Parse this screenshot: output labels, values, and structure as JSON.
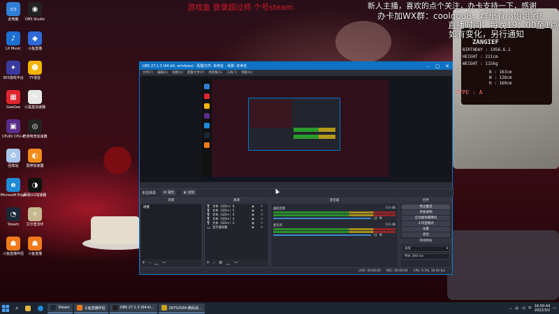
{
  "overlays": {
    "red_text": "游戏盒  登录超过师  个号steam",
    "line1": "新人主播，喜欢的点个关注，办卡支持一下，感谢",
    "line2": "办卡加WX群：coolgou8，群里有小姐姐哟！",
    "line3": "直播时间：每晚19：00至1点",
    "line4": "如有变化，另行通知"
  },
  "wallpaper_text": {
    "name": "ZANGIEF",
    "birthday": "BIRTHDAY : 1956.6.1",
    "height": "HEIGHT : 211cm",
    "weight": "WEIGHT : 115kg",
    "b": "B : 163cm",
    "w": "W : 128cm",
    "h": "H : 160cm",
    "type": "TYPE : A"
  },
  "desktop_icons": [
    {
      "label": "此电脑",
      "icon": "computer-icon",
      "color": "#2f7fd6",
      "glyph": "▭"
    },
    {
      "label": "OBS Studio",
      "icon": "obs-icon",
      "color": "#222222",
      "glyph": "◉"
    },
    {
      "label": "LX Music",
      "icon": "music-icon",
      "color": "#1d6fd1",
      "glyph": "♪"
    },
    {
      "label": "斗鱼直播",
      "icon": "stream-icon",
      "color": "#2d6ad8",
      "glyph": "◆"
    },
    {
      "label": "SES游戏平台",
      "icon": "game-platform-icon",
      "color": "#3a3aa0",
      "glyph": "✦"
    },
    {
      "label": "YY语音",
      "icon": "yy-icon",
      "color": "#f2b400",
      "glyph": "☻"
    },
    {
      "label": "GeeGee",
      "icon": "geegee-icon",
      "color": "#e0252e",
      "glyph": "▦"
    },
    {
      "label": "小黑盒加速器",
      "icon": "accelerator-icon",
      "color": "#e8e8e8",
      "glyph": "✎"
    },
    {
      "label": "CPUID CPU-Z",
      "icon": "cpuz-icon",
      "color": "#5a2d8a",
      "glyph": "▣"
    },
    {
      "label": "奇游电竞加速器",
      "icon": "booster-icon",
      "color": "#222222",
      "glyph": "◎"
    },
    {
      "label": "回收站",
      "icon": "recycle-bin-icon",
      "color": "#a9c7e8",
      "glyph": "♻"
    },
    {
      "label": "雷神加速器",
      "icon": "thunder-icon",
      "color": "#f28a1a",
      "glyph": "◐"
    },
    {
      "label": "Microsoft Edge",
      "icon": "edge-icon",
      "color": "#1f8ad6",
      "glyph": "e"
    },
    {
      "label": "网易UU加速器",
      "icon": "uu-icon",
      "color": "#111111",
      "glyph": "◑"
    },
    {
      "label": "Steam",
      "icon": "steam-icon",
      "color": "#1b2838",
      "glyph": "◔"
    },
    {
      "label": "艾尔登法环",
      "icon": "elden-icon",
      "color": "#c8b890",
      "glyph": "✧"
    },
    {
      "label": "斗鱼直播伴侣",
      "icon": "douyu-companion-icon",
      "color": "#f07a1a",
      "glyph": "☗"
    },
    {
      "label": "斗鱼直播",
      "icon": "douyu-icon",
      "color": "#f07a1a",
      "glyph": "☗"
    }
  ],
  "obs": {
    "title": "OBS 27.1.3 (64-bit, windows) - 配置文件: 未命名 - 场景: 未命名",
    "menu": [
      "文件(F)",
      "编辑(E)",
      "视图(V)",
      "配置文件(P)",
      "场景集(S)",
      "工具(T)",
      "帮助(H)"
    ],
    "toolbar": {
      "no_selection": "未选择源",
      "properties": "属性",
      "filters": "滤镜"
    },
    "docks": {
      "scenes": "场景",
      "sources": "来源",
      "mixer": "混音器",
      "transitions": "转场",
      "controls": "控件"
    },
    "scene_items": [
      "场景"
    ],
    "sources": [
      {
        "name": "文本（GDI+）6"
      },
      {
        "name": "文本（GDI+）5"
      },
      {
        "name": "文本（GDI+）4"
      },
      {
        "name": "文本（GDI+）3"
      },
      {
        "name": "文本（GDI+）2"
      },
      {
        "name": "显示器采集"
      }
    ],
    "mixer": [
      {
        "name": "桌面音频",
        "level": "0.0 dB"
      },
      {
        "name": "麦克风",
        "level": "0.0 dB"
      }
    ],
    "controls": [
      "停止推流",
      "开始录制",
      "启动虚拟摄像机",
      "工作室模式",
      "设置",
      "退出"
    ],
    "transition_label": "转场特效",
    "transition_value": "淡化",
    "duration_label": "时长",
    "duration_value": "300 ms",
    "status": {
      "live": "LIVE: 00:00:00",
      "rec": "REC: 00:00:00",
      "cpu": "CPU: 0.3%, 30.00 fps"
    }
  },
  "taskbar": {
    "apps": [
      {
        "label": "Steam",
        "icon": "steam-icon",
        "color": "#1b2838"
      },
      {
        "label": "斗鱼直播伴侣",
        "icon": "douyu-icon",
        "color": "#f07a1a"
      },
      {
        "label": "OBS 27.1.3 (64-bi...",
        "icon": "obs-icon",
        "color": "#222222"
      },
      {
        "label": "28752584-精武战...",
        "icon": "game-icon",
        "color": "#c9a21c"
      }
    ],
    "time": "16:50:44",
    "date": "2022/3/2"
  }
}
